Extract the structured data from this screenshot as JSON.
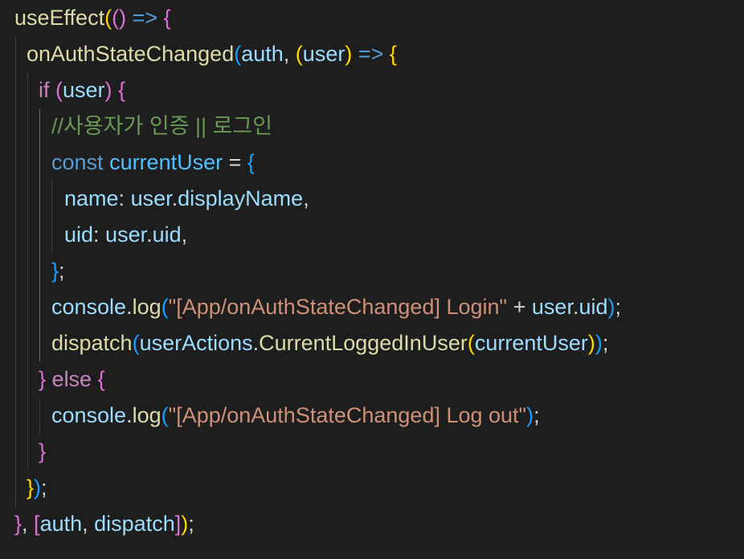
{
  "editor": {
    "lines": [
      [
        {
          "t": "useEffect",
          "c": "fn"
        },
        {
          "t": "(",
          "c": "b1"
        },
        {
          "t": "()",
          "c": "b2"
        },
        {
          "t": " => ",
          "c": "kw"
        },
        {
          "t": "{",
          "c": "b2"
        }
      ],
      [
        {
          "t": "onAuthStateChanged",
          "c": "fn"
        },
        {
          "t": "(",
          "c": "b3"
        },
        {
          "t": "auth",
          "c": "var"
        },
        {
          "t": ", ",
          "c": "plain"
        },
        {
          "t": "(",
          "c": "b1"
        },
        {
          "t": "user",
          "c": "var"
        },
        {
          "t": ")",
          "c": "b1"
        },
        {
          "t": " => ",
          "c": "kw"
        },
        {
          "t": "{",
          "c": "b1"
        }
      ],
      [
        {
          "t": "if",
          "c": "ctl"
        },
        {
          "t": " ",
          "c": "plain"
        },
        {
          "t": "(",
          "c": "b2"
        },
        {
          "t": "user",
          "c": "var"
        },
        {
          "t": ")",
          "c": "b2"
        },
        {
          "t": " ",
          "c": "plain"
        },
        {
          "t": "{",
          "c": "b2"
        }
      ],
      [
        {
          "t": "//사용자가 인증 || 로그인",
          "c": "cmt"
        }
      ],
      [
        {
          "t": "const",
          "c": "kw"
        },
        {
          "t": " ",
          "c": "plain"
        },
        {
          "t": "currentUser",
          "c": "const"
        },
        {
          "t": " = ",
          "c": "plain"
        },
        {
          "t": "{",
          "c": "b3"
        }
      ],
      [
        {
          "t": "name",
          "c": "prop"
        },
        {
          "t": ": ",
          "c": "plain"
        },
        {
          "t": "user",
          "c": "var"
        },
        {
          "t": ".",
          "c": "plain"
        },
        {
          "t": "displayName",
          "c": "prop"
        },
        {
          "t": ",",
          "c": "plain"
        }
      ],
      [
        {
          "t": "uid",
          "c": "prop"
        },
        {
          "t": ": ",
          "c": "plain"
        },
        {
          "t": "user",
          "c": "var"
        },
        {
          "t": ".",
          "c": "plain"
        },
        {
          "t": "uid",
          "c": "prop"
        },
        {
          "t": ",",
          "c": "plain"
        }
      ],
      [
        {
          "t": "}",
          "c": "b3"
        },
        {
          "t": ";",
          "c": "plain"
        }
      ],
      [
        {
          "t": "console",
          "c": "var"
        },
        {
          "t": ".",
          "c": "plain"
        },
        {
          "t": "log",
          "c": "fn"
        },
        {
          "t": "(",
          "c": "b3"
        },
        {
          "t": "\"[App/onAuthStateChanged] Login\"",
          "c": "str"
        },
        {
          "t": " + ",
          "c": "plain"
        },
        {
          "t": "user",
          "c": "var"
        },
        {
          "t": ".",
          "c": "plain"
        },
        {
          "t": "uid",
          "c": "prop"
        },
        {
          "t": ")",
          "c": "b3"
        },
        {
          "t": ";",
          "c": "plain"
        }
      ],
      [
        {
          "t": "dispatch",
          "c": "fn"
        },
        {
          "t": "(",
          "c": "b3"
        },
        {
          "t": "userActions",
          "c": "var"
        },
        {
          "t": ".",
          "c": "plain"
        },
        {
          "t": "CurrentLoggedInUser",
          "c": "fn"
        },
        {
          "t": "(",
          "c": "b1"
        },
        {
          "t": "currentUser",
          "c": "var"
        },
        {
          "t": ")",
          "c": "b1"
        },
        {
          "t": ")",
          "c": "b3"
        },
        {
          "t": ";",
          "c": "plain"
        }
      ],
      [
        {
          "t": "}",
          "c": "b2"
        },
        {
          "t": " ",
          "c": "plain"
        },
        {
          "t": "else",
          "c": "ctl"
        },
        {
          "t": " ",
          "c": "plain"
        },
        {
          "t": "{",
          "c": "b2"
        }
      ],
      [
        {
          "t": "console",
          "c": "var"
        },
        {
          "t": ".",
          "c": "plain"
        },
        {
          "t": "log",
          "c": "fn"
        },
        {
          "t": "(",
          "c": "b3"
        },
        {
          "t": "\"[App/onAuthStateChanged] Log out\"",
          "c": "str"
        },
        {
          "t": ")",
          "c": "b3"
        },
        {
          "t": ";",
          "c": "plain"
        }
      ],
      [
        {
          "t": "}",
          "c": "b2"
        }
      ],
      [
        {
          "t": "}",
          "c": "b1"
        },
        {
          "t": ")",
          "c": "b3"
        },
        {
          "t": ";",
          "c": "plain"
        }
      ],
      [
        {
          "t": "}",
          "c": "b2"
        },
        {
          "t": ", ",
          "c": "plain"
        },
        {
          "t": "[",
          "c": "b2"
        },
        {
          "t": "auth",
          "c": "var"
        },
        {
          "t": ", ",
          "c": "plain"
        },
        {
          "t": "dispatch",
          "c": "var"
        },
        {
          "t": "]",
          "c": "b2"
        },
        {
          "t": ")",
          "c": "b1"
        },
        {
          "t": ";",
          "c": "plain"
        }
      ]
    ]
  },
  "colors": {
    "background": "#1e1e1e",
    "function": "#dcdcaa",
    "keyword": "#569cd6",
    "control": "#c586c0",
    "variable": "#9cdcfe",
    "constant": "#4fc1ff",
    "string": "#ce9178",
    "comment": "#6a9955",
    "bracket_gold": "#ffd700",
    "bracket_orchid": "#da70d6",
    "bracket_blue": "#179fff"
  }
}
